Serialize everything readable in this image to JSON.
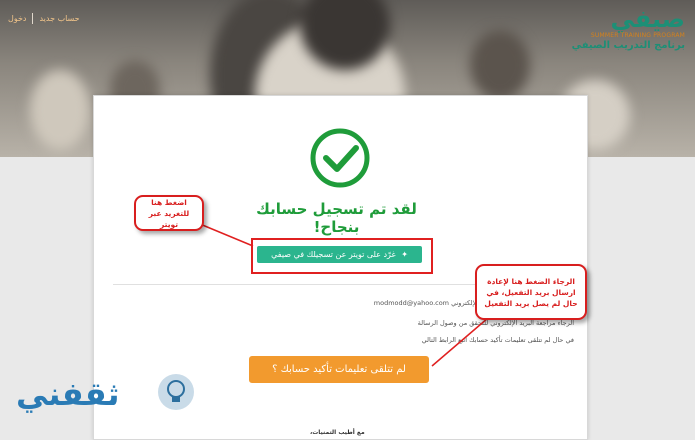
{
  "nav": {
    "register": "حساب جديد",
    "login": "دخول"
  },
  "logo": {
    "name": "صيفي",
    "program_en": "SUMMER TRAINING PROGRAM",
    "program_ar": "برنامج التدريب الصيفي"
  },
  "main": {
    "headline": "لقد تم تسجيل حسابك بنجاح!",
    "tweet_button": "غرّد على تويتر عن تسجيلك في صيفي",
    "info_lines": [
      "تم إرسال رسالة الى صندوق بريدك الإلكتروني modmodd@yahoo.com",
      "الرجاء مراجعة البريد الإلكتروني للتحقق من وصول الرسالة",
      "في حال لم تتلقى تعليمات تأكيد حسابك اتبع الرابط التالي"
    ],
    "resend_button": "لم تتلقى تعليمات تأكيد حسابك ؟",
    "signoff": "مع أطيب التمنيات،"
  },
  "annotations": {
    "tweet_note": "اضغط هنا للتغريد عبر تويتر",
    "resend_note": "الرجاء الضغط هنا لإعادة ارسال بريد التفعيل، في حال لم يصل بريد التفعيل"
  },
  "watermark": {
    "text": "ثقفني"
  },
  "colors": {
    "accent_green": "#1f9c3a",
    "tweet_green": "#2bb58e",
    "orange": "#f29a2e",
    "annotation_red": "#d81e1e",
    "brand_teal": "#1d8f76"
  }
}
